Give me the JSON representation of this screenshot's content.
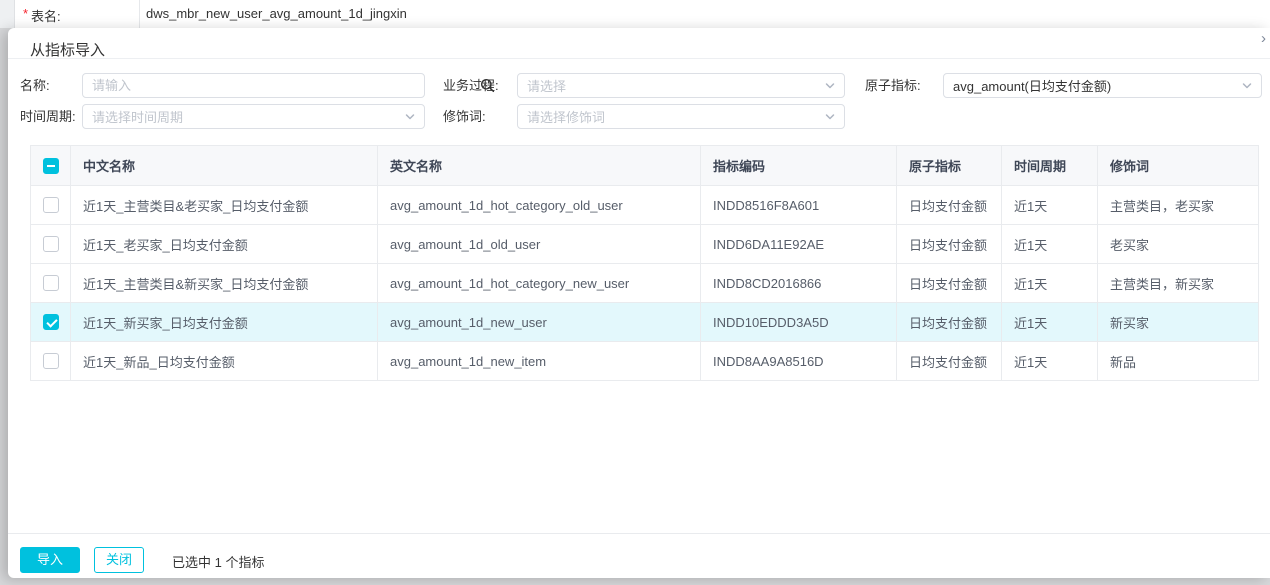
{
  "colors": {
    "accent": "#00C1DE",
    "row_highlight": "#E3F8FC"
  },
  "background_form": {
    "required_mark": "*",
    "table_name_label": "表名:",
    "table_name_value": "dws_mbr_new_user_avg_amount_1d_jingxin"
  },
  "dialog": {
    "title": "从指标导入",
    "collapse_glyph": "›",
    "filters": {
      "name": {
        "label": "名称:",
        "placeholder": "请输入"
      },
      "business_process": {
        "label": "业务过程:",
        "placeholder": "请选择"
      },
      "atomic_indicator": {
        "label": "原子指标:",
        "value": "avg_amount(日均支付金额)"
      },
      "time_period": {
        "label": "时间周期:",
        "placeholder": "请选择时间周期"
      },
      "modifier": {
        "label": "修饰词:",
        "placeholder": "请选择修饰词"
      }
    },
    "table": {
      "columns": [
        "中文名称",
        "英文名称",
        "指标编码",
        "原子指标",
        "时间周期",
        "修饰词"
      ],
      "header_checkbox_state": "indeterminate",
      "rows": [
        {
          "checked": false,
          "cells": [
            "近1天_主营类目&老买家_日均支付金额",
            "avg_amount_1d_hot_category_old_user",
            "INDD8516F8A601",
            "日均支付金额",
            "近1天",
            "主营类目，老买家"
          ]
        },
        {
          "checked": false,
          "cells": [
            "近1天_老买家_日均支付金额",
            "avg_amount_1d_old_user",
            "INDD6DA11E92AE",
            "日均支付金额",
            "近1天",
            "老买家"
          ]
        },
        {
          "checked": false,
          "cells": [
            "近1天_主营类目&新买家_日均支付金额",
            "avg_amount_1d_hot_category_new_user",
            "INDD8CD2016866",
            "日均支付金额",
            "近1天",
            "主营类目，新买家"
          ]
        },
        {
          "checked": true,
          "cells": [
            "近1天_新买家_日均支付金额",
            "avg_amount_1d_new_user",
            "INDD10EDDD3A5D",
            "日均支付金额",
            "近1天",
            "新买家"
          ]
        },
        {
          "checked": false,
          "cells": [
            "近1天_新品_日均支付金额",
            "avg_amount_1d_new_item",
            "INDD8AA9A8516D",
            "日均支付金额",
            "近1天",
            "新品"
          ]
        }
      ]
    },
    "footer": {
      "import_label": "导入",
      "close_label": "关闭",
      "selected_text": "已选中 1 个指标"
    }
  }
}
